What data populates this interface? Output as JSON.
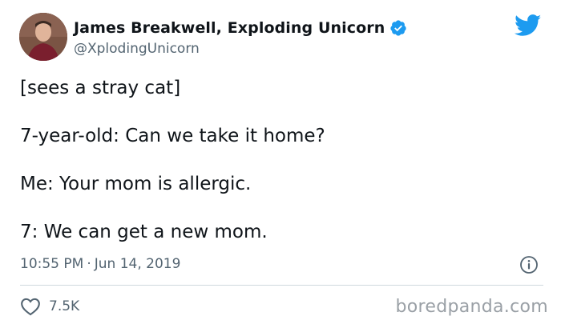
{
  "author": {
    "display_name": "James Breakwell, Exploding Unicorn",
    "handle": "@XplodingUnicorn",
    "verified": true
  },
  "tweet": {
    "lines": [
      "[sees a stray cat]",
      "7-year-old: Can we take it home?",
      "Me: Your mom is allergic.",
      "7: We can get a new mom."
    ],
    "time": "10:55 PM",
    "separator": "·",
    "date": "Jun 14, 2019",
    "like_count": "7.5K"
  },
  "watermark": "boredpanda.com",
  "colors": {
    "twitter_blue": "#1d9bf0",
    "text": "#0f1419",
    "muted": "#536471",
    "divider": "#cfd9de"
  },
  "icons": {
    "logo": "twitter-bird-icon",
    "verified": "verified-badge-icon",
    "info": "info-icon",
    "like": "heart-icon"
  }
}
